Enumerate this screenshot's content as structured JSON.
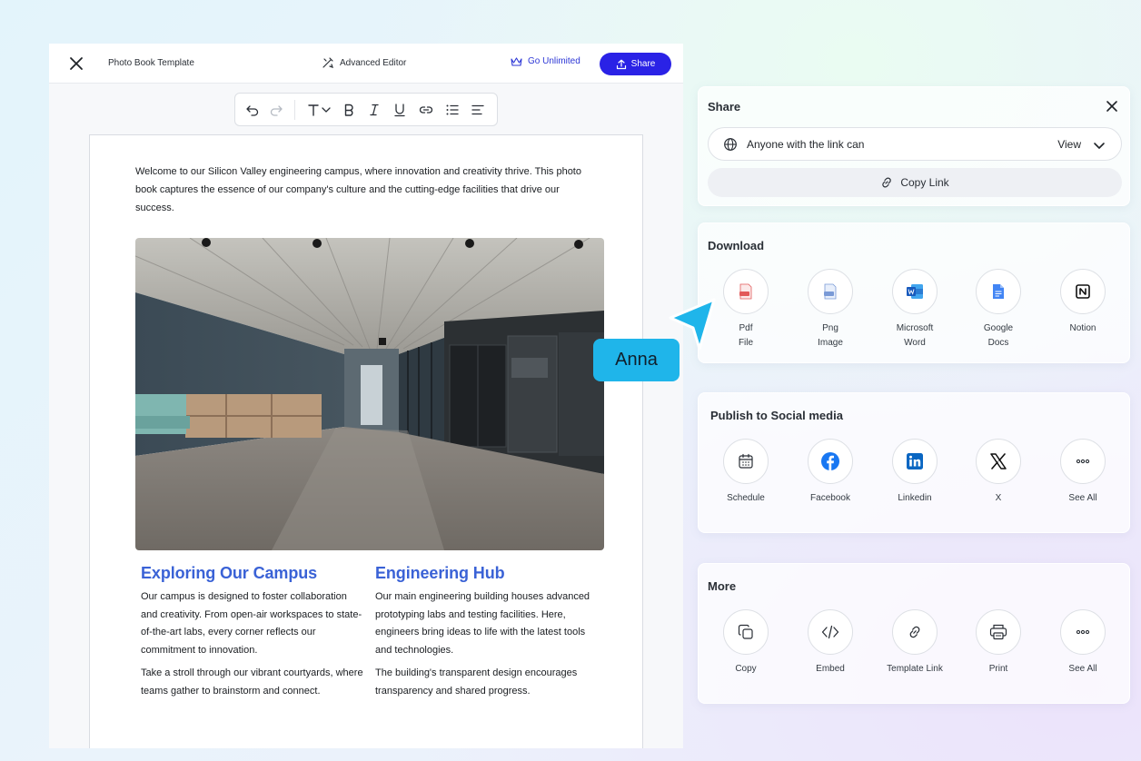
{
  "topbar": {
    "doc_title": "Photo Book Template",
    "advanced_editor": "Advanced Editor",
    "go_unlimited": "Go Unlimited",
    "share": "Share"
  },
  "document": {
    "intro": "Welcome to our Silicon Valley engineering campus, where innovation and creativity thrive. This photo book captures the essence of our company's culture and the cutting-edge facilities that drive our success.",
    "columns": [
      {
        "heading": "Exploring Our Campus",
        "paragraphs": [
          "Our campus is designed to foster collaboration and creativity. From open-air workspaces to state-of-the-art labs, every corner reflects our commitment to innovation.",
          "Take a stroll through our vibrant courtyards, where teams gather to brainstorm and connect."
        ]
      },
      {
        "heading": "Engineering Hub",
        "paragraphs": [
          "Our main engineering building houses advanced prototyping labs and testing facilities. Here, engineers bring ideas to life with the latest tools and technologies.",
          "The building's transparent design encourages transparency and shared progress."
        ]
      }
    ]
  },
  "share_panel": {
    "title": "Share",
    "permission": "Anyone with the link can",
    "permission_value": "View",
    "copy_link": "Copy Link"
  },
  "download": {
    "title": "Download",
    "items": [
      {
        "line1": "Pdf",
        "line2": "File",
        "icon": "pdf-file-icon"
      },
      {
        "line1": "Png",
        "line2": "Image",
        "icon": "png-image-icon"
      },
      {
        "line1": "Microsoft",
        "line2": "Word",
        "icon": "microsoft-word-icon"
      },
      {
        "line1": "Google",
        "line2": "Docs",
        "icon": "google-docs-icon"
      },
      {
        "line1": "Notion",
        "line2": "",
        "icon": "notion-icon"
      }
    ]
  },
  "social": {
    "title": "Publish to Social media",
    "items": [
      {
        "label": "Schedule",
        "icon": "calendar-icon"
      },
      {
        "label": "Facebook",
        "icon": "facebook-icon"
      },
      {
        "label": "Linkedin",
        "icon": "linkedin-icon"
      },
      {
        "label": "X",
        "icon": "x-logo-icon"
      },
      {
        "label": "See All",
        "icon": "more-dots-icon"
      }
    ]
  },
  "more": {
    "title": "More",
    "items": [
      {
        "label": "Copy",
        "icon": "copy-icon"
      },
      {
        "label": "Embed",
        "icon": "code-icon"
      },
      {
        "label": "Template Link",
        "icon": "link-icon"
      },
      {
        "label": "Print",
        "icon": "printer-icon"
      },
      {
        "label": "See All",
        "icon": "more-dots-icon"
      }
    ]
  },
  "collaborator": {
    "name": "Anna",
    "color": "#1fb5ea"
  },
  "colors": {
    "accent": "#2a22e6",
    "heading": "#3a62d6"
  }
}
